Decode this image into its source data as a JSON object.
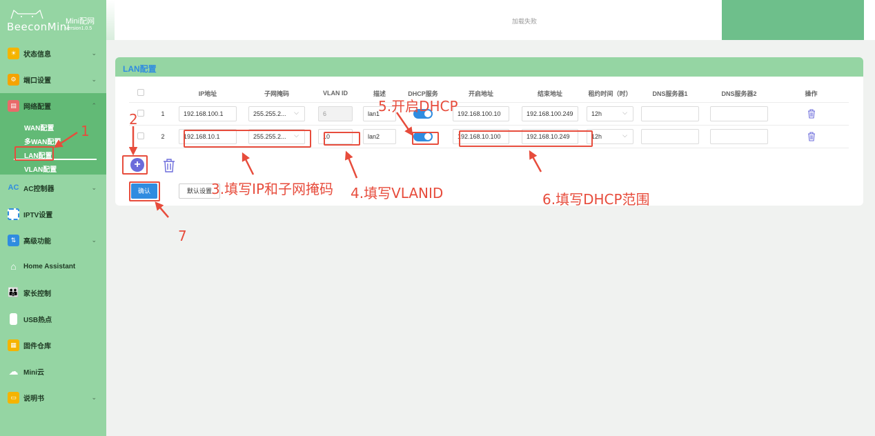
{
  "app": {
    "brand": "BeeconMini",
    "title": "Mini配网",
    "version": "version1.0.5"
  },
  "header": {
    "status_text": "加载失败"
  },
  "sidebar": {
    "items": [
      {
        "label": "状态信息",
        "icon": "status-icon",
        "chevron": "⌄"
      },
      {
        "label": "端口设置",
        "icon": "port-icon",
        "chevron": "⌄"
      },
      {
        "label": "网络配置",
        "icon": "network-icon",
        "chevron": "⌃"
      },
      {
        "label": "AC控制器",
        "icon": "ac-icon",
        "chevron": "⌄"
      },
      {
        "label": "IPTV设置",
        "icon": "iptv-icon",
        "chevron": ""
      },
      {
        "label": "高级功能",
        "icon": "advanced-icon",
        "chevron": "⌄"
      },
      {
        "label": "Home Assistant",
        "icon": "home-icon",
        "chevron": ""
      },
      {
        "label": "家长控制",
        "icon": "family-icon",
        "chevron": ""
      },
      {
        "label": "USB热点",
        "icon": "usb-icon",
        "chevron": ""
      },
      {
        "label": "固件仓库",
        "icon": "firmware-icon",
        "chevron": ""
      },
      {
        "label": "Mini云",
        "icon": "cloud-icon",
        "chevron": ""
      },
      {
        "label": "说明书",
        "icon": "manual-icon",
        "chevron": "⌄"
      }
    ],
    "submenu": [
      "WAN配置",
      "多WAN配置",
      "LAN配置",
      "VLAN配置"
    ],
    "active_sub": "LAN配置"
  },
  "card": {
    "title": "LAN配置",
    "columns": [
      "IP地址",
      "子网掩码",
      "VLAN ID",
      "描述",
      "DHCP服务",
      "开启地址",
      "结束地址",
      "租约时间（时）",
      "DNS服务器1",
      "DNS服务器2",
      "操作"
    ],
    "rows": [
      {
        "index": "1",
        "ip": "192.168.100.1",
        "mask": "255.255.2...",
        "vlan": "6",
        "desc": "lan1",
        "dhcp": true,
        "start": "192.168.100.10",
        "end": "192.168.100.249",
        "lease": "12h",
        "dns1": "",
        "dns2": ""
      },
      {
        "index": "2",
        "ip": "192.168.10.1",
        "mask": "255.255.2...",
        "vlan": "10",
        "desc": "lan2",
        "dhcp": true,
        "start": "192.168.10.100",
        "end": "192.168.10.249",
        "lease": "12h",
        "dns1": "",
        "dns2": ""
      }
    ],
    "confirm_label": "确认",
    "default_label": "默认设置"
  },
  "annotations": {
    "a1": "1",
    "a2": "2",
    "a3": "3.填写IP和子网掩码",
    "a4": "4.填写VLANID",
    "a5": "5.开启DHCP",
    "a6": "6.填写DHCP范围",
    "a7": "7"
  },
  "colors": {
    "sidebar_bg": "#95d5a3",
    "sidebar_active": "#62ba76",
    "accent": "#2f8ce0",
    "annotation": "#e74c3c"
  }
}
